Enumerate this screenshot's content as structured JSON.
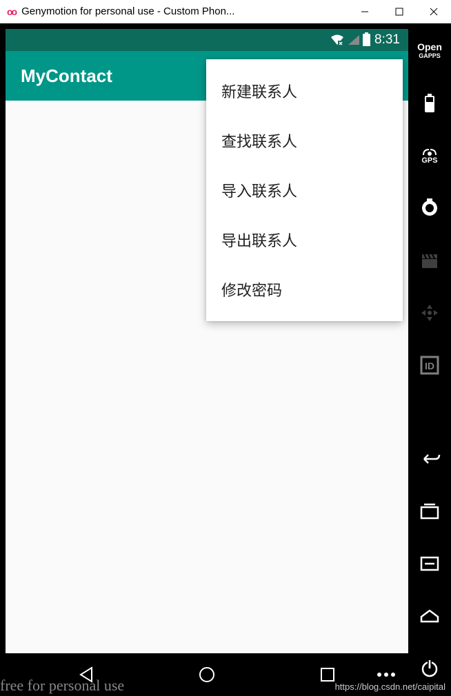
{
  "window": {
    "title": "Genymotion for personal use - Custom Phon..."
  },
  "status": {
    "time": "8:31"
  },
  "app": {
    "title": "MyContact"
  },
  "menu": {
    "items": [
      "新建联系人",
      "查找联系人",
      "导入联系人",
      "导出联系人",
      "修改密码"
    ]
  },
  "sidebar": {
    "open_label": "Open",
    "gapps_label": "GAPPS",
    "gps_label": "GPS",
    "id_label": "ID"
  },
  "watermark": {
    "left": "free for personal use",
    "right": "https://blog.csdn.net/caipital"
  }
}
